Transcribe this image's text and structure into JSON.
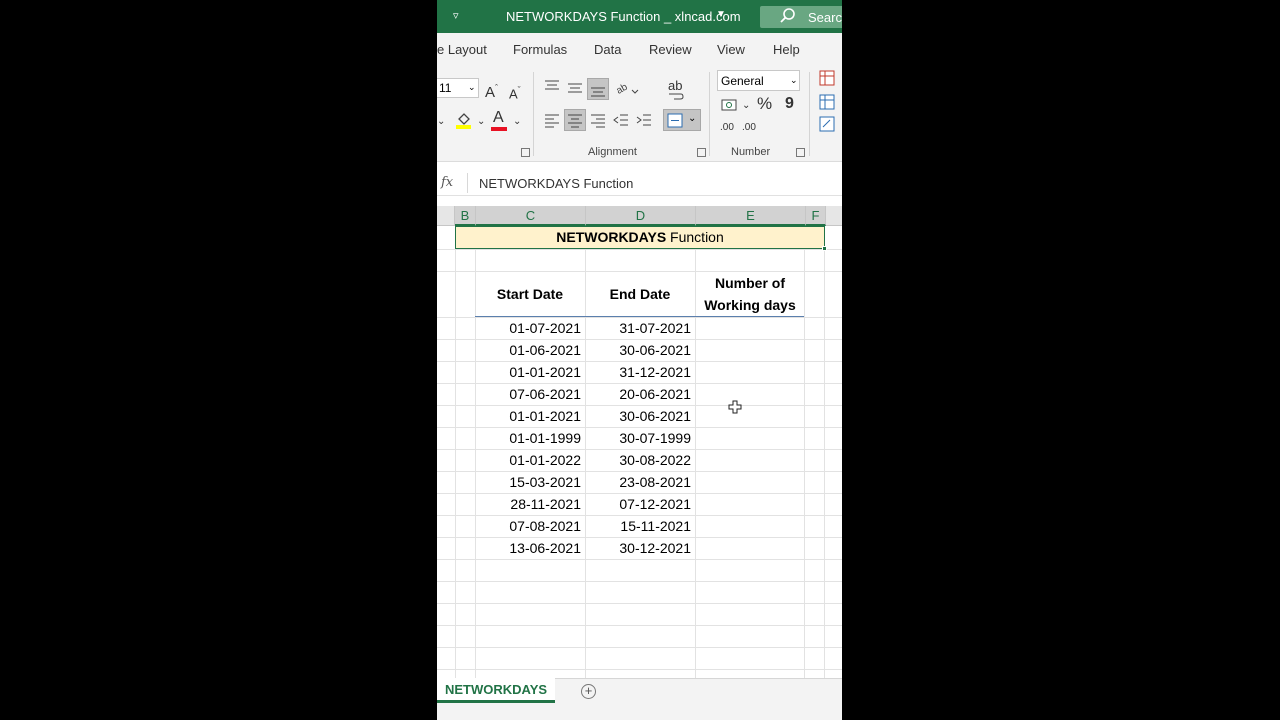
{
  "window": {
    "title": "NETWORKDAYS Function _ xlncad.com",
    "search_label": "Search"
  },
  "ribbon_tabs": [
    "e Layout",
    "Formulas",
    "Data",
    "Review",
    "View",
    "Help"
  ],
  "ribbon": {
    "font_size": "11",
    "alignment_group_label": "Alignment",
    "number_group_label": "Number",
    "number_format": "General",
    "increase_font_glyph": "A",
    "decrease_font_glyph": "A",
    "font_color_glyph": "A",
    "percent_glyph": "%",
    "comma_glyph": "9",
    "wrap_glyph": "ab",
    "inc_decimal_glyph": ".00",
    "dec_decimal_glyph": ".00",
    "font_color_hex": "#e81123",
    "fill_color_hex": "#ffff00"
  },
  "formula_bar": {
    "fx_label": "fx",
    "content": "NETWORKDAYS Function"
  },
  "columns": [
    "B",
    "C",
    "D",
    "E",
    "F"
  ],
  "sheet": {
    "title_bold": "NETWORKDAYS",
    "title_rest": " Function",
    "headers": {
      "start": "Start Date",
      "end": "End Date",
      "working_1": "Number of",
      "working_2": "Working days"
    },
    "rows": [
      {
        "start": "01-07-2021",
        "end": "31-07-2021"
      },
      {
        "start": "01-06-2021",
        "end": "30-06-2021"
      },
      {
        "start": "01-01-2021",
        "end": "31-12-2021"
      },
      {
        "start": "07-06-2021",
        "end": "20-06-2021"
      },
      {
        "start": "01-01-2021",
        "end": "30-06-2021"
      },
      {
        "start": "01-01-1999",
        "end": "30-07-1999"
      },
      {
        "start": "01-01-2022",
        "end": "30-08-2022"
      },
      {
        "start": "15-03-2021",
        "end": "23-08-2021"
      },
      {
        "start": "28-11-2021",
        "end": "07-12-2021"
      },
      {
        "start": "07-08-2021",
        "end": "15-11-2021"
      },
      {
        "start": "13-06-2021",
        "end": "30-12-2021"
      }
    ]
  },
  "sheet_tabs": [
    "NETWORKDAYS"
  ],
  "add_sheet_glyph": "+",
  "theme": {
    "accent": "#217346",
    "title_fill": "#fff2cc"
  }
}
